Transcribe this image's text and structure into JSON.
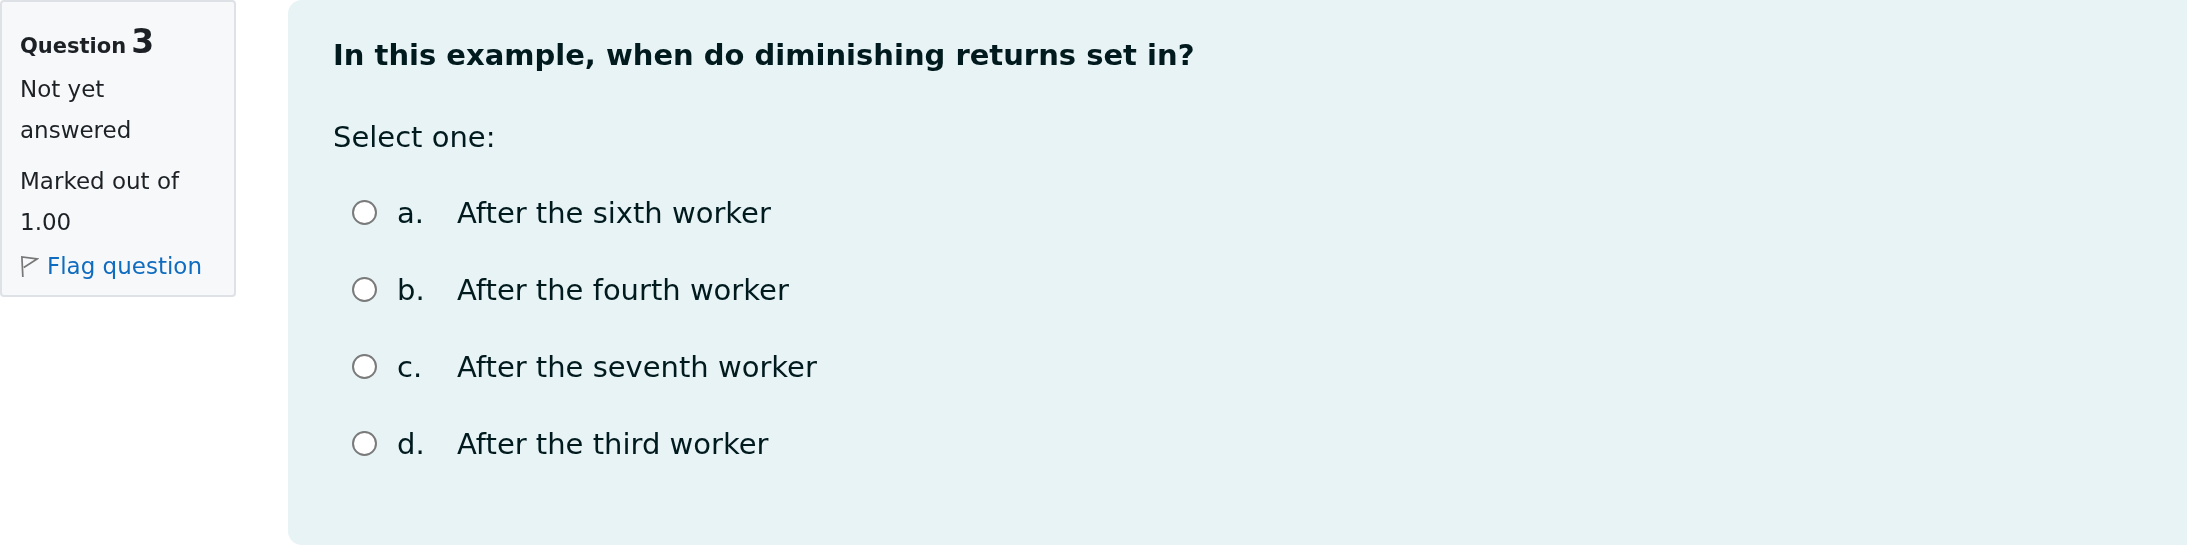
{
  "info": {
    "label": "Question",
    "number": "3",
    "status": "Not yet answered",
    "mark": "Marked out of 1.00",
    "flag": {
      "label": "Flag question",
      "flagged": false
    }
  },
  "question": {
    "text": "In this example, when do diminishing returns set in?",
    "prompt": "Select one:",
    "options": [
      {
        "letter": "a.",
        "text": "After the sixth worker",
        "selected": false
      },
      {
        "letter": "b.",
        "text": "After the fourth worker",
        "selected": false
      },
      {
        "letter": "c.",
        "text": "After the seventh worker",
        "selected": false
      },
      {
        "letter": "d.",
        "text": "After the third worker",
        "selected": false
      }
    ]
  }
}
